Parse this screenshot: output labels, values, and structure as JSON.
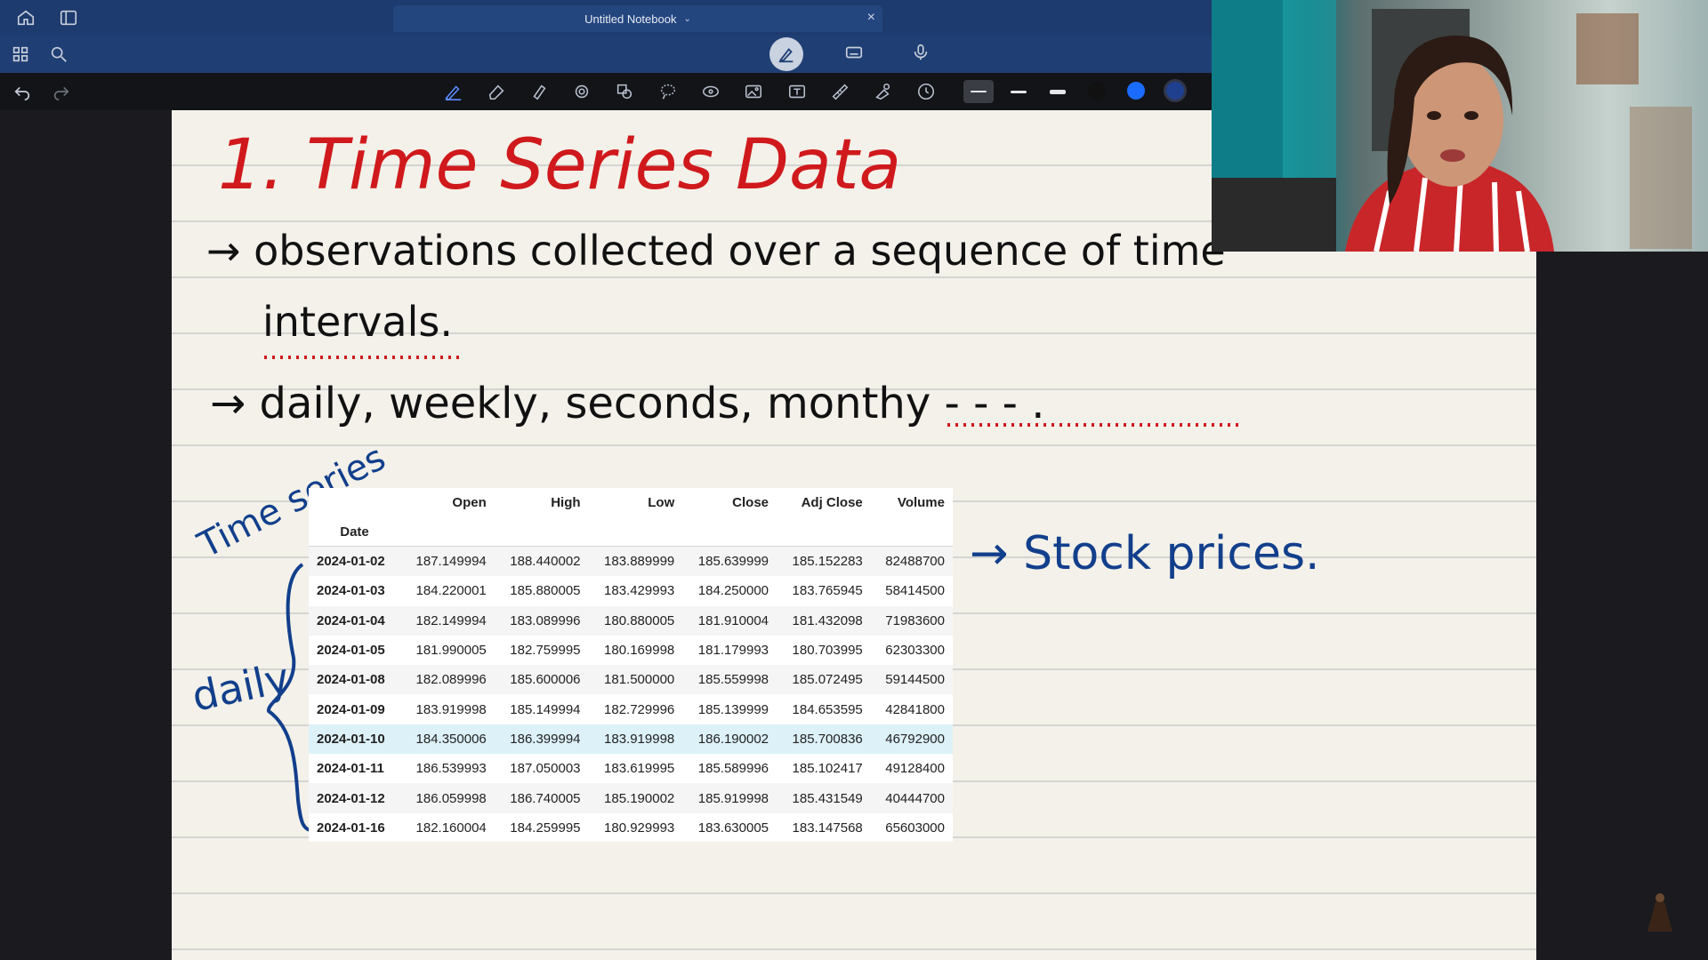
{
  "app": {
    "notebook_title": "Untitled Notebook",
    "icons": [
      "home-icon",
      "sidebar-icon",
      "grid-icon",
      "search-icon",
      "undo-icon",
      "redo-icon",
      "close-icon",
      "handwriting-icon",
      "keyboard-icon",
      "microphone-icon"
    ]
  },
  "toolbar": {
    "tools": [
      "pen-icon",
      "eraser-icon",
      "highlighter-icon",
      "shape-icon",
      "zoom-icon",
      "lasso-icon",
      "laser-icon",
      "image-icon",
      "textbox-icon",
      "ruler-icon",
      "element-icon",
      "clock-icon"
    ],
    "selected_tool": "pen-icon",
    "colors": [
      "#111111",
      "#1a6cff",
      "#1f3f8f"
    ],
    "accent": "#5b8cff"
  },
  "notes": {
    "heading": "1. Time Series Data",
    "bullet1_line1": "→ observations collected over a sequence of time",
    "bullet1_line2": "intervals.",
    "bullet2": "→ daily, weekly, seconds, monthy - - - .",
    "side_label_time_series": "Time series",
    "side_label_daily": "daily",
    "right_note": "→ Stock prices."
  },
  "table": {
    "columns": [
      "Open",
      "High",
      "Low",
      "Close",
      "Adj Close",
      "Volume"
    ],
    "index_label": "Date",
    "rows": [
      {
        "date": "2024-01-02",
        "values": [
          "187.149994",
          "188.440002",
          "183.889999",
          "185.639999",
          "185.152283",
          "82488700"
        ]
      },
      {
        "date": "2024-01-03",
        "values": [
          "184.220001",
          "185.880005",
          "183.429993",
          "184.250000",
          "183.765945",
          "58414500"
        ]
      },
      {
        "date": "2024-01-04",
        "values": [
          "182.149994",
          "183.089996",
          "180.880005",
          "181.910004",
          "181.432098",
          "71983600"
        ]
      },
      {
        "date": "2024-01-05",
        "values": [
          "181.990005",
          "182.759995",
          "180.169998",
          "181.179993",
          "180.703995",
          "62303300"
        ]
      },
      {
        "date": "2024-01-08",
        "values": [
          "182.089996",
          "185.600006",
          "181.500000",
          "185.559998",
          "185.072495",
          "59144500"
        ]
      },
      {
        "date": "2024-01-09",
        "values": [
          "183.919998",
          "185.149994",
          "182.729996",
          "185.139999",
          "184.653595",
          "42841800"
        ]
      },
      {
        "date": "2024-01-10",
        "values": [
          "184.350006",
          "186.399994",
          "183.919998",
          "186.190002",
          "185.700836",
          "46792900"
        ]
      },
      {
        "date": "2024-01-11",
        "values": [
          "186.539993",
          "187.050003",
          "183.619995",
          "185.589996",
          "185.102417",
          "49128400"
        ]
      },
      {
        "date": "2024-01-12",
        "values": [
          "186.059998",
          "186.740005",
          "185.190002",
          "185.919998",
          "185.431549",
          "40444700"
        ]
      },
      {
        "date": "2024-01-16",
        "values": [
          "182.160004",
          "184.259995",
          "180.929993",
          "183.630005",
          "183.147568",
          "65603000"
        ]
      }
    ],
    "highlighted_row": "2024-01-10"
  },
  "webcam": {
    "label": "presenter-video"
  },
  "colors": {
    "ink_red": "#d0191c",
    "ink_black": "#111111",
    "ink_blue": "#123f8c",
    "page_bg": "#f3f1e9"
  }
}
